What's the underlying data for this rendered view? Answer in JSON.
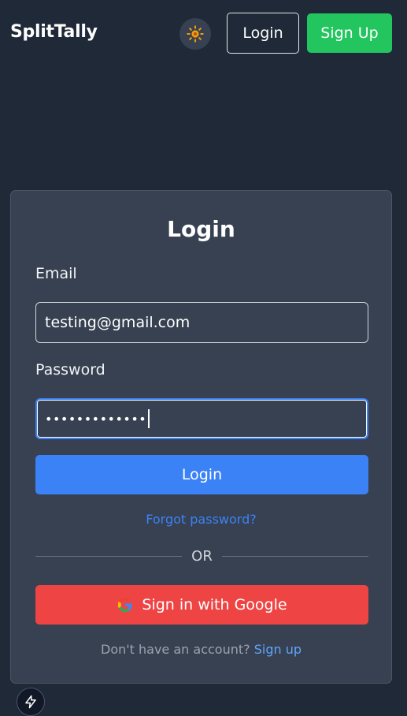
{
  "header": {
    "brand": "SplitTally",
    "theme_icon": "sun-icon",
    "login_label": "Login",
    "signup_label": "Sign Up"
  },
  "form": {
    "title": "Login",
    "email_label": "Email",
    "email_value": "testing@gmail.com",
    "password_label": "Password",
    "password_mask": "•••••••••••••",
    "submit_label": "Login",
    "forgot_label": "Forgot password?",
    "divider_label": "OR",
    "google_label": "Sign in with Google",
    "no_account_text": "Don't have an account?",
    "signup_link": "Sign up"
  },
  "colors": {
    "background": "#1f2937",
    "card": "#374151",
    "primary": "#3b82f6",
    "success": "#22c55e",
    "danger": "#ef4444",
    "sun": "#f59e0b"
  }
}
